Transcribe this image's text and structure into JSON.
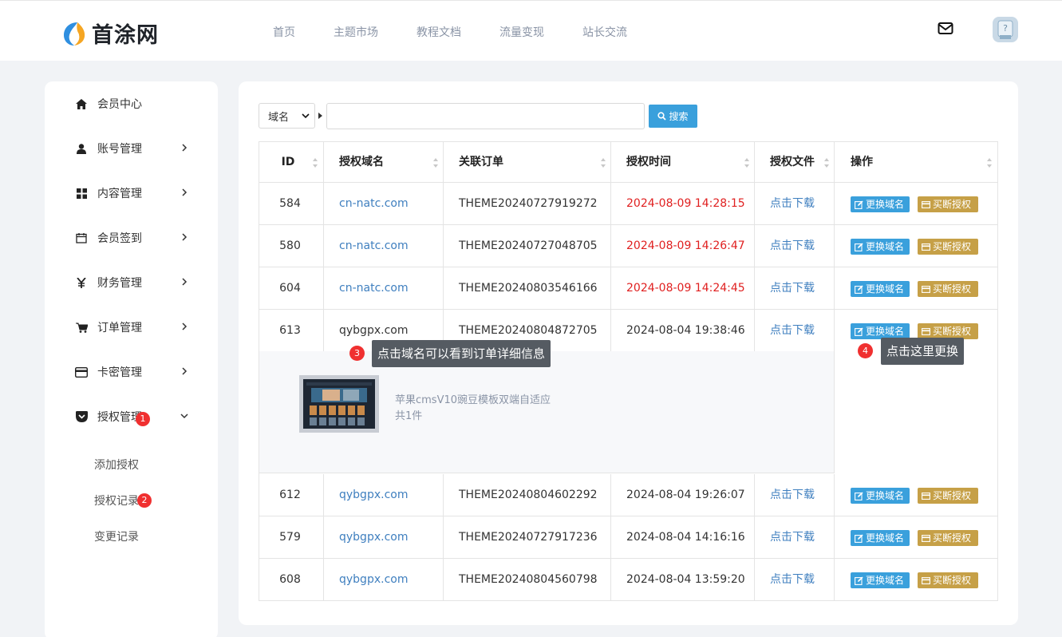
{
  "header": {
    "logo_text": "首涂网",
    "nav": [
      "首页",
      "主题市场",
      "教程文档",
      "流量变现",
      "站长交流"
    ]
  },
  "sidebar": {
    "items": [
      {
        "label": "会员中心",
        "icon": "home-icon"
      },
      {
        "label": "账号管理",
        "icon": "user-icon"
      },
      {
        "label": "内容管理",
        "icon": "grid-icon"
      },
      {
        "label": "会员签到",
        "icon": "calendar-icon"
      },
      {
        "label": "财务管理",
        "icon": "yen-icon"
      },
      {
        "label": "订单管理",
        "icon": "cart-icon"
      },
      {
        "label": "卡密管理",
        "icon": "card-icon"
      },
      {
        "label": "授权管理",
        "icon": "pocket-icon",
        "badge": "1"
      }
    ],
    "sub_items": [
      {
        "label": "添加授权"
      },
      {
        "label": "授权记录",
        "badge": "2"
      },
      {
        "label": "变更记录"
      }
    ]
  },
  "search": {
    "select_value": "域名",
    "button_label": "搜索"
  },
  "table": {
    "headers": [
      "ID",
      "授权域名",
      "关联订单",
      "授权时间",
      "授权文件",
      "操作"
    ],
    "rows": [
      {
        "id": "584",
        "domain": "cn-natc.com",
        "order": "THEME20240727919272",
        "time": "2024-08-09 14:28:15",
        "file": "点击下载",
        "expired": true
      },
      {
        "id": "580",
        "domain": "cn-natc.com",
        "order": "THEME20240727048705",
        "time": "2024-08-09 14:26:47",
        "file": "点击下载",
        "expired": true
      },
      {
        "id": "604",
        "domain": "cn-natc.com",
        "order": "THEME20240803546166",
        "time": "2024-08-09 14:24:45",
        "file": "点击下载",
        "expired": true
      },
      {
        "id": "613",
        "domain": "qybgpx.com",
        "order": "THEME20240804872705",
        "time": "2024-08-04 19:38:46",
        "file": "点击下载",
        "expired": false
      },
      {
        "id": "612",
        "domain": "qybgpx.com",
        "order": "THEME20240804602292",
        "time": "2024-08-04 19:26:07",
        "file": "点击下载",
        "expired": false
      },
      {
        "id": "579",
        "domain": "qybgpx.com",
        "order": "THEME20240727917236",
        "time": "2024-08-04 14:16:16",
        "file": "点击下载",
        "expired": false
      },
      {
        "id": "608",
        "domain": "qybgpx.com",
        "order": "THEME20240804560798",
        "time": "2024-08-04 13:59:20",
        "file": "点击下载",
        "expired": false
      }
    ],
    "action_change": "更换域名",
    "action_buy": "买断授权",
    "detail": {
      "product_name": "苹果cmsV10豌豆模板双端自适应",
      "count": "共1件"
    }
  },
  "tips": [
    {
      "num": "3",
      "text": "点击域名可以看到订单详细信息"
    },
    {
      "num": "4",
      "text": "点击这里更换"
    }
  ],
  "colors": {
    "accent": "#3aa0dc",
    "gold": "#c6a047",
    "expired": "#e02020",
    "badge": "#f03030"
  }
}
